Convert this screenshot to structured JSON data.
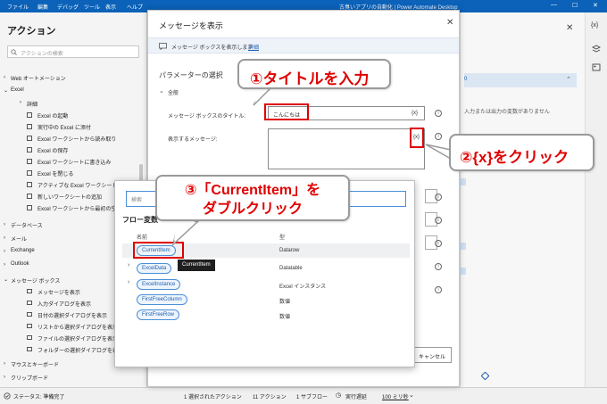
{
  "titlebar": {
    "menu": [
      "ファイル",
      "編集",
      "デバッグ",
      "ツール",
      "表示",
      "ヘルプ"
    ],
    "window_title": "古臭いアプリの自動化 | Power Automate Desktop",
    "window_controls": [
      "—",
      "☐",
      "✕"
    ]
  },
  "actions_panel": {
    "title": "アクション",
    "search_placeholder": "アクションの検索",
    "items": [
      {
        "label": "Web オートメーション",
        "kind": "group"
      },
      {
        "label": "Excel",
        "kind": "group-open"
      },
      {
        "label": "詳細",
        "kind": "subgroup"
      },
      {
        "label": "Excel の起動",
        "kind": "action"
      },
      {
        "label": "実行中の Excel に添付",
        "kind": "action"
      },
      {
        "label": "Excel ワークシートから読み取り",
        "kind": "action"
      },
      {
        "label": "Excel の保存",
        "kind": "action"
      },
      {
        "label": "Excel ワークシートに書き込み",
        "kind": "action"
      },
      {
        "label": "Excel を閉じる",
        "kind": "action"
      },
      {
        "label": "アクティブな Excel ワークシートの設定",
        "kind": "action"
      },
      {
        "label": "新しいワークシートの追加",
        "kind": "action"
      },
      {
        "label": "Excel ワークシートから最初の空の列や行を取得",
        "kind": "action"
      },
      {
        "label": "データベース",
        "kind": "group"
      },
      {
        "label": "メール",
        "kind": "group"
      },
      {
        "label": "Exchange",
        "kind": "group"
      },
      {
        "label": "Outlook",
        "kind": "group"
      },
      {
        "label": "メッセージ ボックス",
        "kind": "group-open"
      },
      {
        "label": "メッセージを表示",
        "kind": "action"
      },
      {
        "label": "入力ダイアログを表示",
        "kind": "action"
      },
      {
        "label": "日付の選択ダイアログを表示",
        "kind": "action"
      },
      {
        "label": "リストから選択ダイアログを表示",
        "kind": "action"
      },
      {
        "label": "ファイルの選択ダイアログを表示",
        "kind": "action"
      },
      {
        "label": "フォルダーの選択ダイアログを表示",
        "kind": "action"
      },
      {
        "label": "マウスとキーボード",
        "kind": "group"
      },
      {
        "label": "クリップボード",
        "kind": "group"
      }
    ]
  },
  "dialog": {
    "title": "メッセージを表示",
    "close": "✕",
    "info_text": "メッセージ ボックスを表示します",
    "info_link": "詳細",
    "section_title": "パラメーターの選択",
    "group_label": "全般",
    "fields": {
      "title_label": "メッセージ ボックスのタイトル:",
      "title_value": "こんにちは",
      "message_label": "表示するメッセージ:",
      "var_button": "{x}"
    },
    "cancel_label": "キャンセル"
  },
  "variable_popup": {
    "search_placeholder": "検索",
    "heading": "フロー変数",
    "col_name": "名前",
    "col_type": "型",
    "tooltip": "CurrentItem",
    "rows": [
      {
        "name": "CurrentItem",
        "type": "Datarow",
        "expandable": false
      },
      {
        "name": "ExcelData",
        "type": "Datatable",
        "expandable": true
      },
      {
        "name": "ExcelInstance",
        "type": "Excel インスタンス",
        "expandable": true
      },
      {
        "name": "FirstFreeColumn",
        "type": "数値",
        "expandable": false
      },
      {
        "name": "FirstFreeRow",
        "type": "数値",
        "expandable": false
      }
    ]
  },
  "variables_panel": {
    "header_tail": "0",
    "empty_text_1": "入力または出力の変数がありません"
  },
  "statusbar": {
    "status": "ステータス: 準備完了",
    "selected": "1 選択されたアクション",
    "actions": "11 アクション",
    "subflows": "1 サブフロー",
    "delay_label": "実行遅延",
    "delay_value": "100 ミリ秒"
  },
  "annotations": {
    "step1": "①タイトルを入力",
    "step2": "②{x}をクリック",
    "step3_line1": "③「CurrentItem」を",
    "step3_line2": "ダブルクリック"
  },
  "colors": {
    "brand": "#0b62b8",
    "annotation_red": "#e00000",
    "link": "#1e5fb0"
  }
}
